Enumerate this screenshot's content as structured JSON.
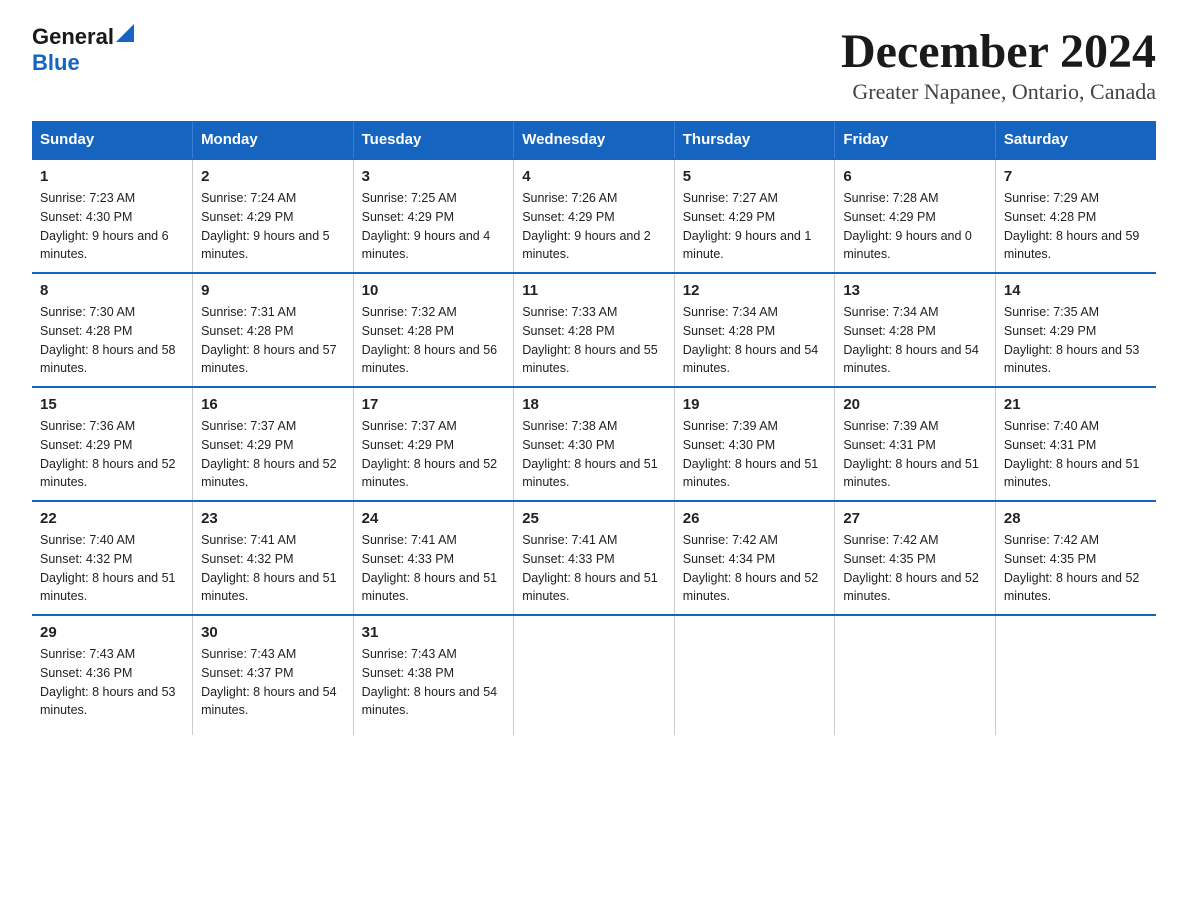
{
  "logo": {
    "general": "General",
    "blue": "Blue"
  },
  "title": "December 2024",
  "subtitle": "Greater Napanee, Ontario, Canada",
  "days_of_week": [
    "Sunday",
    "Monday",
    "Tuesday",
    "Wednesday",
    "Thursday",
    "Friday",
    "Saturday"
  ],
  "weeks": [
    [
      {
        "day": "1",
        "sunrise": "7:23 AM",
        "sunset": "4:30 PM",
        "daylight": "9 hours and 6 minutes."
      },
      {
        "day": "2",
        "sunrise": "7:24 AM",
        "sunset": "4:29 PM",
        "daylight": "9 hours and 5 minutes."
      },
      {
        "day": "3",
        "sunrise": "7:25 AM",
        "sunset": "4:29 PM",
        "daylight": "9 hours and 4 minutes."
      },
      {
        "day": "4",
        "sunrise": "7:26 AM",
        "sunset": "4:29 PM",
        "daylight": "9 hours and 2 minutes."
      },
      {
        "day": "5",
        "sunrise": "7:27 AM",
        "sunset": "4:29 PM",
        "daylight": "9 hours and 1 minute."
      },
      {
        "day": "6",
        "sunrise": "7:28 AM",
        "sunset": "4:29 PM",
        "daylight": "9 hours and 0 minutes."
      },
      {
        "day": "7",
        "sunrise": "7:29 AM",
        "sunset": "4:28 PM",
        "daylight": "8 hours and 59 minutes."
      }
    ],
    [
      {
        "day": "8",
        "sunrise": "7:30 AM",
        "sunset": "4:28 PM",
        "daylight": "8 hours and 58 minutes."
      },
      {
        "day": "9",
        "sunrise": "7:31 AM",
        "sunset": "4:28 PM",
        "daylight": "8 hours and 57 minutes."
      },
      {
        "day": "10",
        "sunrise": "7:32 AM",
        "sunset": "4:28 PM",
        "daylight": "8 hours and 56 minutes."
      },
      {
        "day": "11",
        "sunrise": "7:33 AM",
        "sunset": "4:28 PM",
        "daylight": "8 hours and 55 minutes."
      },
      {
        "day": "12",
        "sunrise": "7:34 AM",
        "sunset": "4:28 PM",
        "daylight": "8 hours and 54 minutes."
      },
      {
        "day": "13",
        "sunrise": "7:34 AM",
        "sunset": "4:28 PM",
        "daylight": "8 hours and 54 minutes."
      },
      {
        "day": "14",
        "sunrise": "7:35 AM",
        "sunset": "4:29 PM",
        "daylight": "8 hours and 53 minutes."
      }
    ],
    [
      {
        "day": "15",
        "sunrise": "7:36 AM",
        "sunset": "4:29 PM",
        "daylight": "8 hours and 52 minutes."
      },
      {
        "day": "16",
        "sunrise": "7:37 AM",
        "sunset": "4:29 PM",
        "daylight": "8 hours and 52 minutes."
      },
      {
        "day": "17",
        "sunrise": "7:37 AM",
        "sunset": "4:29 PM",
        "daylight": "8 hours and 52 minutes."
      },
      {
        "day": "18",
        "sunrise": "7:38 AM",
        "sunset": "4:30 PM",
        "daylight": "8 hours and 51 minutes."
      },
      {
        "day": "19",
        "sunrise": "7:39 AM",
        "sunset": "4:30 PM",
        "daylight": "8 hours and 51 minutes."
      },
      {
        "day": "20",
        "sunrise": "7:39 AM",
        "sunset": "4:31 PM",
        "daylight": "8 hours and 51 minutes."
      },
      {
        "day": "21",
        "sunrise": "7:40 AM",
        "sunset": "4:31 PM",
        "daylight": "8 hours and 51 minutes."
      }
    ],
    [
      {
        "day": "22",
        "sunrise": "7:40 AM",
        "sunset": "4:32 PM",
        "daylight": "8 hours and 51 minutes."
      },
      {
        "day": "23",
        "sunrise": "7:41 AM",
        "sunset": "4:32 PM",
        "daylight": "8 hours and 51 minutes."
      },
      {
        "day": "24",
        "sunrise": "7:41 AM",
        "sunset": "4:33 PM",
        "daylight": "8 hours and 51 minutes."
      },
      {
        "day": "25",
        "sunrise": "7:41 AM",
        "sunset": "4:33 PM",
        "daylight": "8 hours and 51 minutes."
      },
      {
        "day": "26",
        "sunrise": "7:42 AM",
        "sunset": "4:34 PM",
        "daylight": "8 hours and 52 minutes."
      },
      {
        "day": "27",
        "sunrise": "7:42 AM",
        "sunset": "4:35 PM",
        "daylight": "8 hours and 52 minutes."
      },
      {
        "day": "28",
        "sunrise": "7:42 AM",
        "sunset": "4:35 PM",
        "daylight": "8 hours and 52 minutes."
      }
    ],
    [
      {
        "day": "29",
        "sunrise": "7:43 AM",
        "sunset": "4:36 PM",
        "daylight": "8 hours and 53 minutes."
      },
      {
        "day": "30",
        "sunrise": "7:43 AM",
        "sunset": "4:37 PM",
        "daylight": "8 hours and 54 minutes."
      },
      {
        "day": "31",
        "sunrise": "7:43 AM",
        "sunset": "4:38 PM",
        "daylight": "8 hours and 54 minutes."
      },
      null,
      null,
      null,
      null
    ]
  ],
  "labels": {
    "sunrise": "Sunrise:",
    "sunset": "Sunset:",
    "daylight": "Daylight:"
  }
}
